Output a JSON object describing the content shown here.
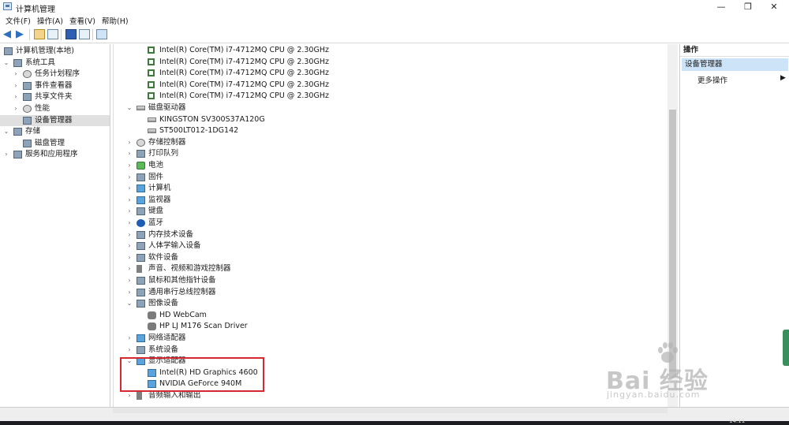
{
  "window": {
    "title": "计算机管理",
    "minimize": "—",
    "maximize": "❐",
    "close": "✕"
  },
  "menu": [
    "文件(F)",
    "操作(A)",
    "查看(V)",
    "帮助(H)"
  ],
  "left_tree": [
    {
      "label": "计算机管理(本地)",
      "indent": 0,
      "expander": "",
      "icon": "computer-management-icon"
    },
    {
      "label": "系统工具",
      "indent": 1,
      "expander": "v",
      "icon": "tools-icon"
    },
    {
      "label": "任务计划程序",
      "indent": 2,
      "expander": ">",
      "icon": "clock-icon"
    },
    {
      "label": "事件查看器",
      "indent": 2,
      "expander": ">",
      "icon": "event-viewer-icon"
    },
    {
      "label": "共享文件夹",
      "indent": 2,
      "expander": ">",
      "icon": "shared-folder-icon"
    },
    {
      "label": "性能",
      "indent": 2,
      "expander": ">",
      "icon": "performance-icon"
    },
    {
      "label": "设备管理器",
      "indent": 2,
      "expander": "",
      "icon": "device-manager-icon",
      "selected": true
    },
    {
      "label": "存储",
      "indent": 1,
      "expander": "v",
      "icon": "storage-icon"
    },
    {
      "label": "磁盘管理",
      "indent": 2,
      "expander": "",
      "icon": "disk-icon"
    },
    {
      "label": "服务和应用程序",
      "indent": 1,
      "expander": ">",
      "icon": "services-icon"
    }
  ],
  "device_tree": [
    {
      "label": "Intel(R) Core(TM) i7-4712MQ CPU @ 2.30GHz",
      "indent": 2,
      "expander": "",
      "icon": "processor-icon"
    },
    {
      "label": "Intel(R) Core(TM) i7-4712MQ CPU @ 2.30GHz",
      "indent": 2,
      "expander": "",
      "icon": "processor-icon"
    },
    {
      "label": "Intel(R) Core(TM) i7-4712MQ CPU @ 2.30GHz",
      "indent": 2,
      "expander": "",
      "icon": "processor-icon"
    },
    {
      "label": "Intel(R) Core(TM) i7-4712MQ CPU @ 2.30GHz",
      "indent": 2,
      "expander": "",
      "icon": "processor-icon"
    },
    {
      "label": "Intel(R) Core(TM) i7-4712MQ CPU @ 2.30GHz",
      "indent": 2,
      "expander": "",
      "icon": "processor-icon"
    },
    {
      "label": "磁盘驱动器",
      "indent": 1,
      "expander": "v",
      "icon": "disk-drive-icon"
    },
    {
      "label": "KINGSTON SV300S37A120G",
      "indent": 2,
      "expander": "",
      "icon": "disk-drive-icon"
    },
    {
      "label": "ST500LT012-1DG142",
      "indent": 2,
      "expander": "",
      "icon": "disk-drive-icon"
    },
    {
      "label": "存储控制器",
      "indent": 1,
      "expander": ">",
      "icon": "storage-controller-icon"
    },
    {
      "label": "打印队列",
      "indent": 1,
      "expander": ">",
      "icon": "printer-icon"
    },
    {
      "label": "电池",
      "indent": 1,
      "expander": ">",
      "icon": "battery-icon"
    },
    {
      "label": "固件",
      "indent": 1,
      "expander": ">",
      "icon": "firmware-icon"
    },
    {
      "label": "计算机",
      "indent": 1,
      "expander": ">",
      "icon": "computer-icon"
    },
    {
      "label": "监视器",
      "indent": 1,
      "expander": ">",
      "icon": "monitor-icon"
    },
    {
      "label": "键盘",
      "indent": 1,
      "expander": ">",
      "icon": "keyboard-icon"
    },
    {
      "label": "蓝牙",
      "indent": 1,
      "expander": ">",
      "icon": "bluetooth-icon"
    },
    {
      "label": "内存技术设备",
      "indent": 1,
      "expander": ">",
      "icon": "memory-device-icon"
    },
    {
      "label": "人体学输入设备",
      "indent": 1,
      "expander": ">",
      "icon": "hid-icon"
    },
    {
      "label": "软件设备",
      "indent": 1,
      "expander": ">",
      "icon": "software-device-icon"
    },
    {
      "label": "声音、视频和游戏控制器",
      "indent": 1,
      "expander": ">",
      "icon": "sound-icon"
    },
    {
      "label": "鼠标和其他指针设备",
      "indent": 1,
      "expander": ">",
      "icon": "mouse-icon"
    },
    {
      "label": "通用串行总线控制器",
      "indent": 1,
      "expander": ">",
      "icon": "usb-icon"
    },
    {
      "label": "图像设备",
      "indent": 1,
      "expander": "v",
      "icon": "imaging-device-icon"
    },
    {
      "label": "HD WebCam",
      "indent": 2,
      "expander": "",
      "icon": "webcam-icon"
    },
    {
      "label": "HP LJ M176 Scan Driver",
      "indent": 2,
      "expander": "",
      "icon": "scanner-icon"
    },
    {
      "label": "网络适配器",
      "indent": 1,
      "expander": ">",
      "icon": "network-adapter-icon"
    },
    {
      "label": "系统设备",
      "indent": 1,
      "expander": ">",
      "icon": "system-device-icon"
    },
    {
      "label": "显示适配器",
      "indent": 1,
      "expander": "v",
      "icon": "display-adapter-icon"
    },
    {
      "label": "Intel(R) HD Graphics 4600",
      "indent": 2,
      "expander": "",
      "icon": "display-adapter-icon"
    },
    {
      "label": "NVIDIA GeForce 940M",
      "indent": 2,
      "expander": "",
      "icon": "display-adapter-icon"
    },
    {
      "label": "音频输入和输出",
      "indent": 1,
      "expander": ">",
      "icon": "audio-io-icon"
    }
  ],
  "actions_pane": {
    "header": "操作",
    "selected": "设备管理器",
    "more": "更多操作",
    "more_arrow": "▶"
  },
  "watermark": {
    "brand": "Bai 经验",
    "url": "jingyan.baidu.com"
  },
  "status": {
    "clock": "14:11"
  }
}
